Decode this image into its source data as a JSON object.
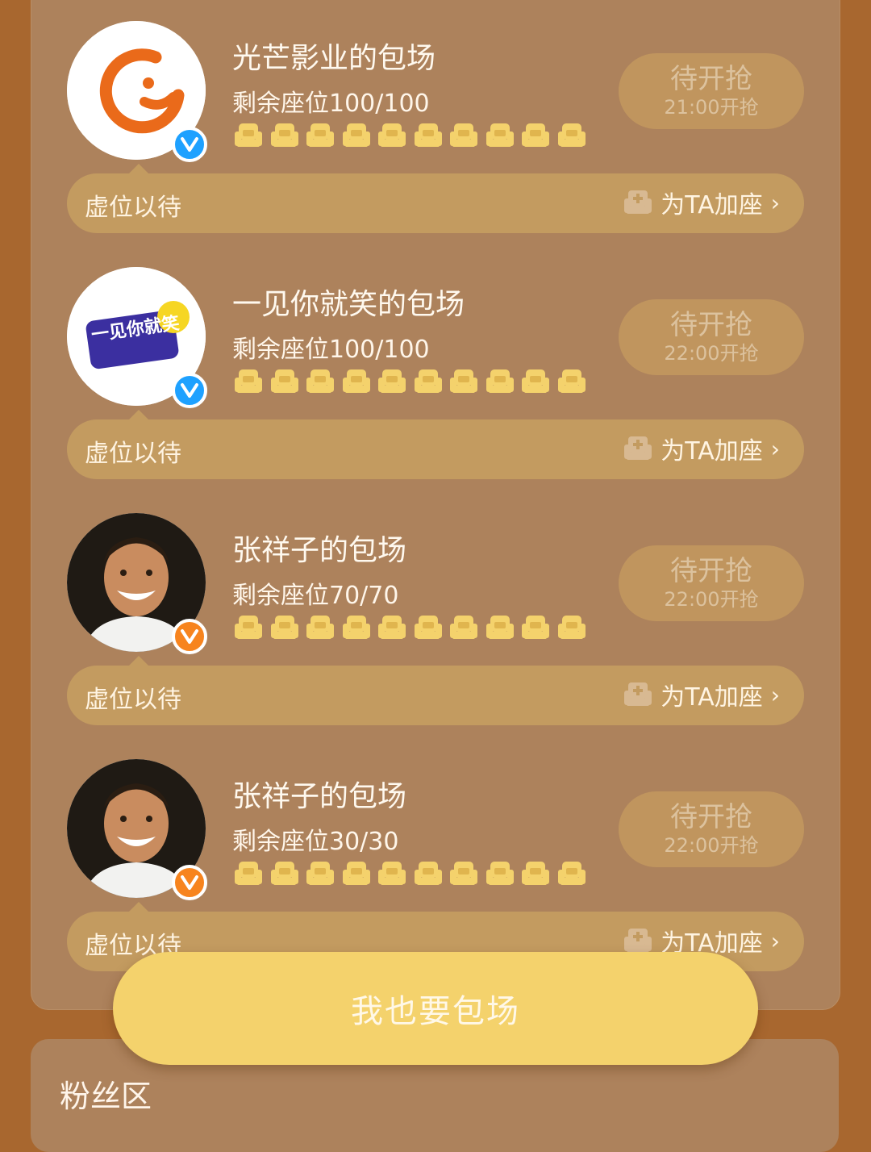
{
  "cards": [
    {
      "title": "光芒影业的包场",
      "seats": "剩余座位100/100",
      "badge": "blue",
      "button_main": "待开抢",
      "button_time": "21:00开抢",
      "bar_left": "虚位以待",
      "bar_right": "为TA加座",
      "avatar_text": ""
    },
    {
      "title": "一见你就笑的包场",
      "seats": "剩余座位100/100",
      "badge": "blue",
      "button_main": "待开抢",
      "button_time": "22:00开抢",
      "bar_left": "虚位以待",
      "bar_right": "为TA加座",
      "avatar_text": "一见你就笑"
    },
    {
      "title": "张祥子的包场",
      "seats": "剩余座位70/70",
      "badge": "orange",
      "button_main": "待开抢",
      "button_time": "22:00开抢",
      "bar_left": "虚位以待",
      "bar_right": "为TA加座",
      "avatar_text": ""
    },
    {
      "title": "张祥子的包场",
      "seats": "剩余座位30/30",
      "badge": "orange",
      "button_main": "待开抢",
      "button_time": "22:00开抢",
      "bar_left": "虚位以待",
      "bar_right": "为TA加座",
      "avatar_text": ""
    }
  ],
  "seat_icons_per_card": 10,
  "cta_label": "我也要包场",
  "fan_section_title": "粉丝区",
  "colors": {
    "background": "#a8672f",
    "panel": "#ad825c",
    "seat": "#f4d26c",
    "cta": "#f4d26c",
    "badge_blue": "#1ea1ff",
    "badge_orange": "#f7841e"
  }
}
